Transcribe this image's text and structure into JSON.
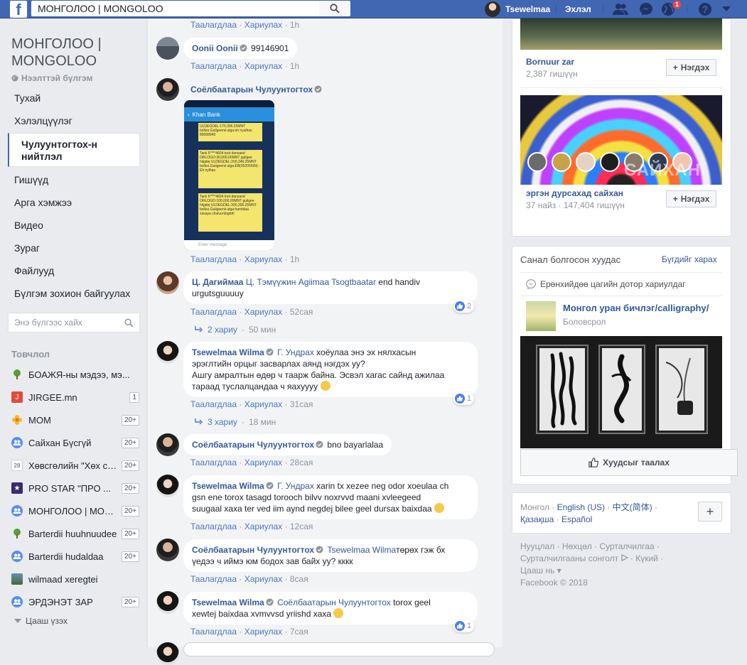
{
  "topbar": {
    "logo": "f",
    "search_value": "МОНГОЛОО | MONGOLOO",
    "user_name": "Tsewelmaa",
    "home_label": "Эхлэл",
    "notification_count": "1",
    "icons": [
      "friends-icon",
      "messenger-icon",
      "globe-icon",
      "help-icon",
      "caret-down-icon"
    ]
  },
  "sidebar": {
    "group_title": "МОНГОЛОО | MONGOLOO",
    "group_type": "Нээлттэй бүлгэм",
    "nav": [
      {
        "label": "Тухай"
      },
      {
        "label": "Хэлэлцүүлэг"
      },
      {
        "label": "Чулуунтогтох-н нийтлэл",
        "active": true
      },
      {
        "label": "Гишүүд"
      },
      {
        "label": "Арга хэмжээ"
      },
      {
        "label": "Видео"
      },
      {
        "label": "Зураг"
      },
      {
        "label": "Файлууд"
      },
      {
        "label": "Бүлгэм зохион байгуулах"
      }
    ],
    "search_placeholder": "Энэ бүлгээс хайх",
    "shortcuts_title": "Товчлол",
    "shortcuts": [
      {
        "label": "БОАЖЯ-ны мэдээ, мэ...",
        "count": "",
        "icon": "tree-icon",
        "color": "#5b9b3a"
      },
      {
        "label": "JIRGEE.mn",
        "count": "1",
        "icon": "jirgee-icon",
        "color": "#e14b3b"
      },
      {
        "label": "MOM",
        "count": "20+",
        "icon": "flower-icon",
        "color": "#f5b82e"
      },
      {
        "label": "Сайхан Бүсгүй",
        "count": "20+",
        "icon": "group-icon",
        "color": "#5b8def"
      },
      {
        "label": "Хөвсгөлийн \"Хөх сувд\"...",
        "count": "20+",
        "icon": "calendar-icon",
        "color": "#ffffff"
      },
      {
        "label": "PRO STAR \"ПРО ...",
        "count": "20+",
        "icon": "star-icon",
        "color": "#3b2a6b"
      },
      {
        "label": "МОНГОЛОО | MONGO...",
        "count": "20+",
        "icon": "group-icon",
        "color": "#5b8def"
      },
      {
        "label": "Barterdii huuhnuudee",
        "count": "20+",
        "icon": "tree-icon",
        "color": "#5b9b3a"
      },
      {
        "label": "Barterdii hudaldaa",
        "count": "20+",
        "icon": "group-icon",
        "color": "#5b8def"
      },
      {
        "label": "wilmaad xeregtei",
        "count": "",
        "icon": "image-icon",
        "color": "#3f6b3a"
      },
      {
        "label": "ЭРДЭНЭТ ЗАР",
        "count": "20+",
        "icon": "group-icon",
        "color": "#5b8def"
      }
    ],
    "see_more": "Цааш үзэх"
  },
  "comments": {
    "like_label": "Таалагдлаа",
    "reply_label": "Хариулах",
    "sep": "·",
    "top_time": "1h",
    "items": [
      {
        "author": "Oonii Oonii",
        "text": "99146901",
        "time": "1h"
      },
      {
        "author": "Соёлбаатарын Чулуунтогтох",
        "text": "",
        "time": "1h"
      },
      {
        "author": "Ц. Дагиймаа",
        "mention": "Ц. Тэмүүжин Agiimaa Tsogtbaatar",
        "text": " end handiv",
        "text2": "urgutsguuuuy",
        "time": "52сая",
        "reactions": "2",
        "replies": "2 хариу",
        "replies_time": "50 мин"
      },
      {
        "author": "Tsewelmaa Wilma",
        "mention": "Г. Ундрах",
        "text": " хоёулаа энэ эх нялхасын",
        "text2": "эрэглтийн орцыг засварлах аянд нэгдэх уу?",
        "text3": "Ашгу амралтын өдөр ч таарж байна. Эсвэл хагас сайнд ажилаа",
        "text4": "тараад туслалцандаа ч яахуууу",
        "time": "31сая",
        "reactions": "1",
        "replies": "3 хариу",
        "replies_time": "18 мин"
      },
      {
        "author": "Соёлбаатарын Чулуунтогтох",
        "text": " bno bayarlalaa",
        "time": "28сая"
      },
      {
        "author": "Tsewelmaa Wilma",
        "mention": "Г. Ундрах",
        "text": " xarin tx xezee neg odor xoeulaa ch",
        "text2": "gsn ene torox tasagd torooch bilvv noxrvvd maani xvleegeed",
        "text3": "suugaal xaxa ter ved iim aynd negdej bilee geel dursax baixdaa",
        "time": "12сая"
      },
      {
        "author": "Соёлбаатарын Чулуунтогтох",
        "mention": "Tsewelmaa Wilma",
        "text": "төрөх гэж бх",
        "text2": "үедээ ч иймэ юм бодох зав байх уу? кккк",
        "time": "8сая"
      },
      {
        "author": "Tsewelmaa Wilma",
        "mention": "Соёлбаатарын Чулуунтогтох",
        "text": " torox geel",
        "text2": "xewtej baixdaa xvmvvsd yriishd xaxa",
        "time": "7сая",
        "reactions": "1"
      }
    ],
    "phone": {
      "bar_title": "Khan Bank",
      "msg1": "ULDEGDEL:170,396.25MNT bolloo.Guilgeenii utga:eh nyalhas 89068945",
      "msg2": "Tanii 5****4604 toot dansand ORLOGO:30,000.00MNT guilgee hiigdej ULDEGDEL:200,346.25MNT bolloo.Guilgeenii utga:EB(95205599) - Eh nylhas",
      "msg3": "Tanii 5****4604 toot dansand ORLOGO:100,000.00MNT guilgee hiigdej ULDEGDEL:300,396.25MNT bolloo.Guilgeenii utga:hamtdaa zasaya chuluuntogtoh",
      "input_placeholder": "Enter message"
    }
  },
  "right": {
    "group1": {
      "name": "Bornuur zar",
      "meta": "2,387 гишүүн",
      "join": "Нэгдэх"
    },
    "group2": {
      "name": "эргэн дурсахад сайхан",
      "meta": "37 найз · 147,404 гишүүн",
      "join": "Нэгдэх",
      "overlay": "САЙХАН"
    },
    "recommended": {
      "title": "Санал болгосон хуудас",
      "see_all": "Бүгдийг харах",
      "response": "Ерөнхийдөө цагийн дотор хариулдаг",
      "page_name": "Монгол уран бичлэг/calligraphy/",
      "page_category": "Боловсрол",
      "like_page": "Хуудсыг таалах"
    },
    "languages": {
      "current": "Монгол",
      "links": [
        "English (US)",
        "中文(简体)",
        "Қазақша",
        "Español"
      ]
    },
    "footer": {
      "line1": [
        "Нууцлал",
        "Нөхцөл",
        "Сурталчилгаа"
      ],
      "line2": [
        "Сурталчилгааны сонголт",
        "Күкий"
      ],
      "line3": "Цааш нь",
      "copyright": "Facebook © 2018"
    }
  }
}
